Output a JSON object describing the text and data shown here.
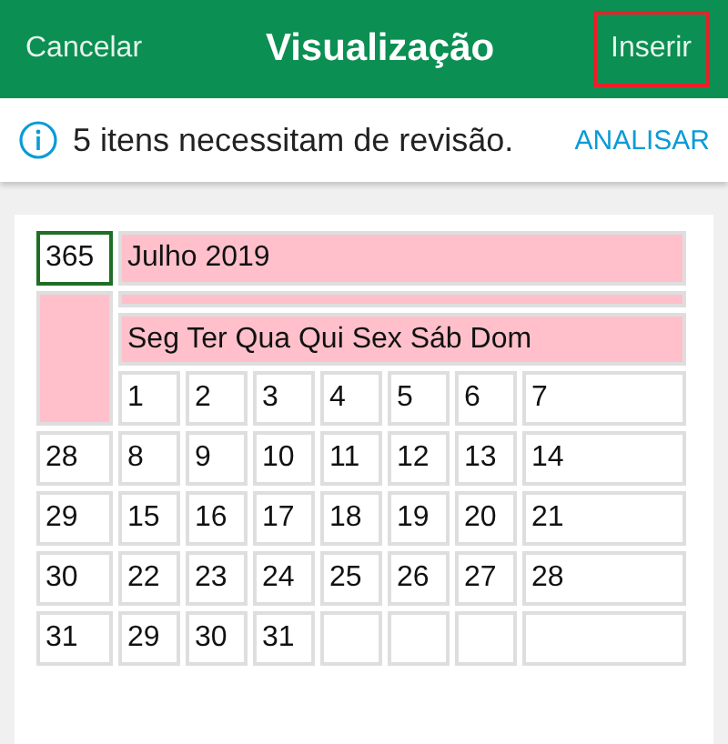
{
  "header": {
    "cancel": "Cancelar",
    "title": "Visualização",
    "insert": {
      "label": "Inserir",
      "highlighted": true
    }
  },
  "notice": {
    "message": "5 itens necessitam de revisão.",
    "action": "ANALISAR"
  },
  "sheet": {
    "corner": {
      "text": "365",
      "selected": true
    },
    "title": "Julho 2019",
    "weekdays": "Seg Ter Qua Qui Sex Sáb Dom",
    "weeks": [
      {
        "days": [
          "1",
          "2",
          "3",
          "4",
          "5",
          "6",
          "7"
        ]
      },
      {
        "label": "28",
        "days": [
          "8",
          "9",
          "10",
          "11",
          "12",
          "13",
          "14"
        ]
      },
      {
        "label": "29",
        "days": [
          "15",
          "16",
          "17",
          "18",
          "19",
          "20",
          "21"
        ]
      },
      {
        "label": "30",
        "days": [
          "22",
          "23",
          "24",
          "25",
          "26",
          "27",
          "28"
        ]
      },
      {
        "label": "31",
        "days": [
          "29",
          "30",
          "31"
        ]
      }
    ]
  }
}
